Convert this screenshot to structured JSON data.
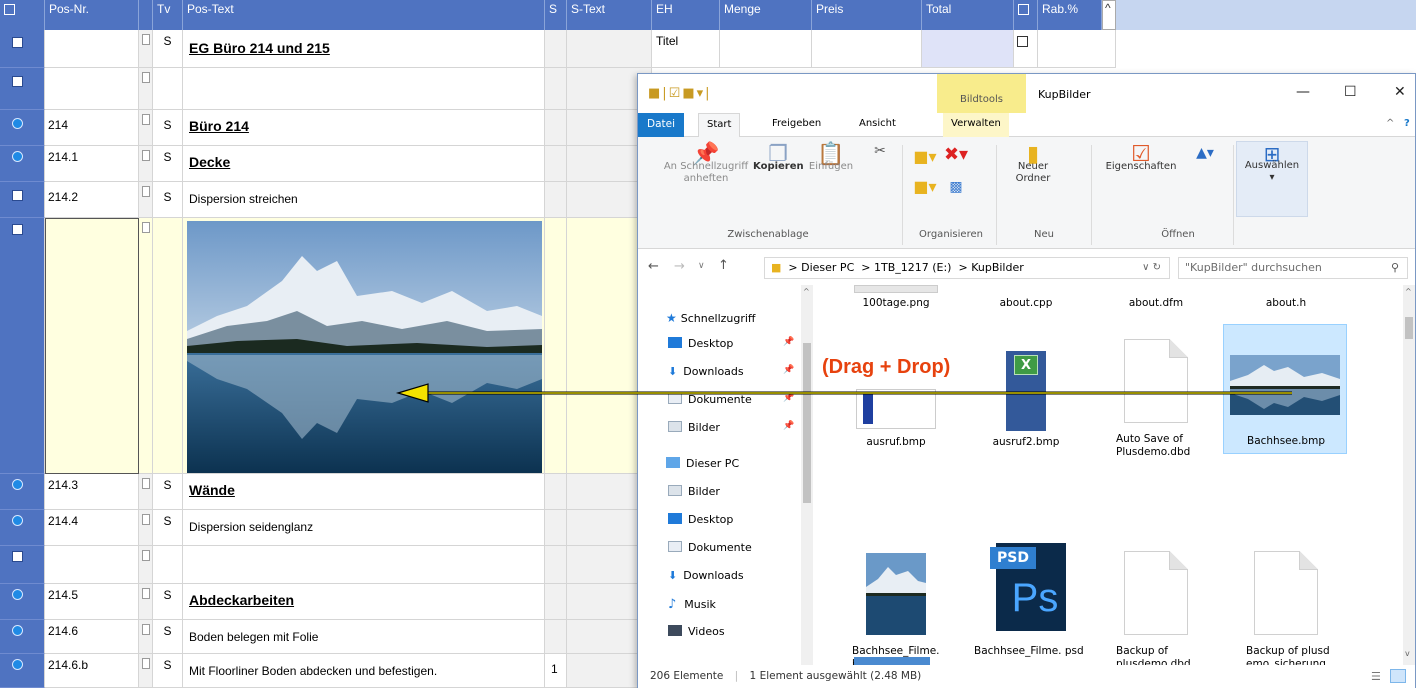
{
  "grid": {
    "headers": {
      "posnr": "Pos-Nr.",
      "tv": "Tv",
      "postext": "Pos-Text",
      "s": "S",
      "stext": "S-Text",
      "eh": "EH",
      "menge": "Menge",
      "preis": "Preis",
      "total": "Total",
      "rab": "Rab.%"
    },
    "rows": [
      {
        "pos": "",
        "tv": "S",
        "text": "EG Büro 214 und 215",
        "eh": "Titel"
      },
      {
        "pos": "",
        "tv": "",
        "text": ""
      },
      {
        "pos": "214",
        "tv": "S",
        "text": "Büro 214"
      },
      {
        "pos": "214.1",
        "tv": "S",
        "text": "Decke"
      },
      {
        "pos": "214.2",
        "tv": "S",
        "text": "Dispersion streichen"
      },
      {
        "pos": "214.3",
        "tv": "S",
        "text": "Wände"
      },
      {
        "pos": "214.4",
        "tv": "S",
        "text": "Dispersion seidenglanz"
      },
      {
        "pos": "",
        "tv": "",
        "text": ""
      },
      {
        "pos": "214.5",
        "tv": "S",
        "text": "Abdeckarbeiten"
      },
      {
        "pos": "214.6",
        "tv": "S",
        "text": "Boden belegen mit Folie"
      },
      {
        "pos": "214.6.b",
        "tv": "S",
        "text": "Mit Floorliner Boden abdecken und befestigen.",
        "s": "1"
      }
    ]
  },
  "annotation": {
    "drag_drop": "(Drag + Drop)"
  },
  "explorer": {
    "title": "KupBilder",
    "context_tab": "Bildtools",
    "tabs": [
      "Datei",
      "Start",
      "Freigeben",
      "Ansicht",
      "Verwalten"
    ],
    "ribbon": {
      "pin": "An Schnellzugriff anheften",
      "copy": "Kopieren",
      "paste": "Einfügen",
      "new_folder": "Neuer Ordner",
      "properties": "Eigenschaften",
      "select": "Auswählen",
      "groups": [
        "Zwischenablage",
        "Organisieren",
        "Neu",
        "Öffnen"
      ]
    },
    "address": {
      "crumbs": [
        "Dieser PC",
        "1TB_1217 (E:)",
        "KupBilder"
      ],
      "search_placeholder": "\"KupBilder\" durchsuchen"
    },
    "nav": {
      "quick_access": "Schnellzugriff",
      "qa_items": [
        "Desktop",
        "Downloads",
        "Dokumente",
        "Bilder"
      ],
      "this_pc": "Dieser PC",
      "pc_items": [
        "Bilder",
        "Desktop",
        "Dokumente",
        "Downloads",
        "Musik",
        "Videos"
      ]
    },
    "files": {
      "row0": [
        "100tage.png",
        "about.cpp",
        "about.dfm",
        "about.h"
      ],
      "row1": [
        "ausruf.bmp",
        "ausruf2.bmp",
        "Auto Save of Plusdemo.dbd",
        "Bachhsee.bmp"
      ],
      "row2": [
        "Bachhsee_Filme. bmp",
        "Bachhsee_Filme. psd",
        "Backup of plusdemo.dbd",
        "Backup of plusdemo_sicherung.dbd"
      ]
    },
    "psd_label": "PSD",
    "ps_label": "Ps",
    "status": {
      "count": "206 Elemente",
      "selection": "1 Element ausgewählt (2.48 MB)"
    }
  }
}
